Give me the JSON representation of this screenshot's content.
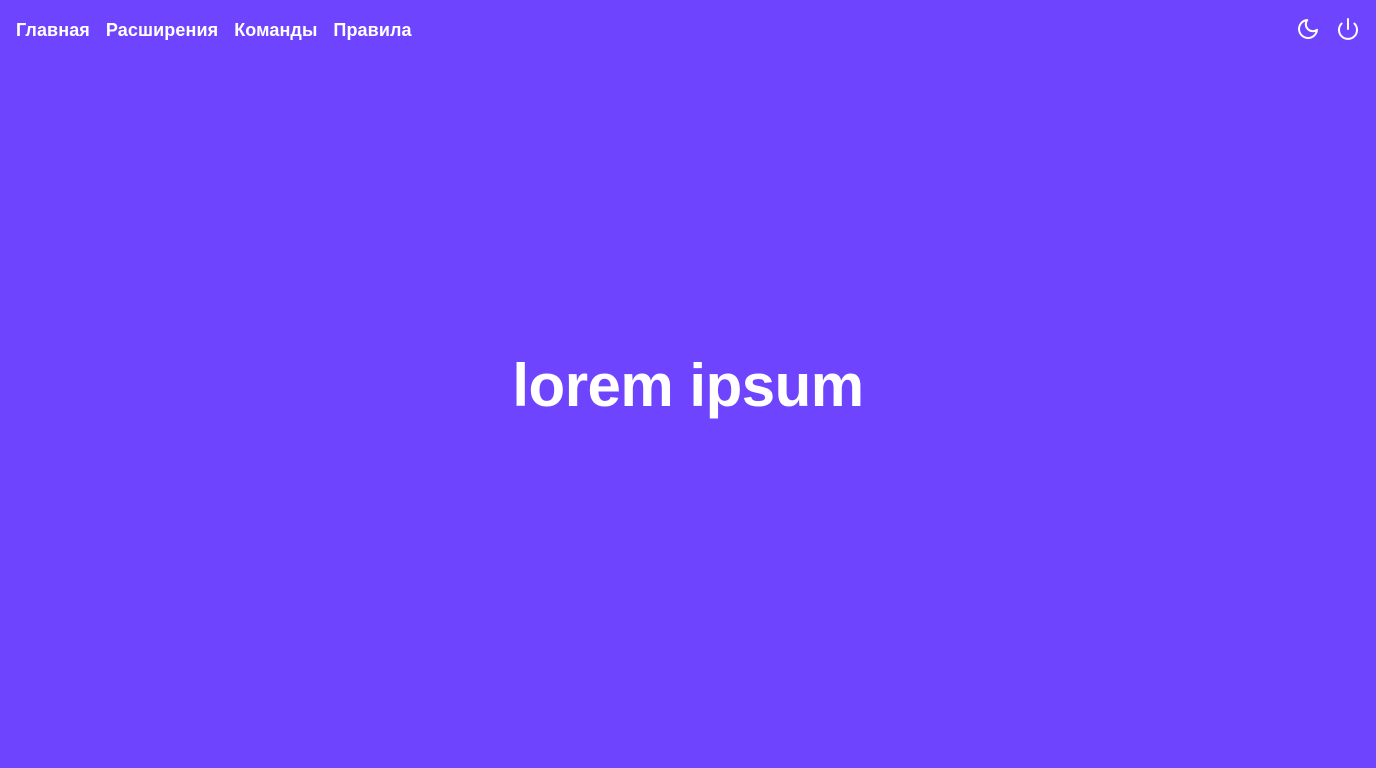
{
  "theme": {
    "background": "#6e44ff",
    "foreground": "#ffffff"
  },
  "nav": {
    "items": [
      {
        "label": "Главная"
      },
      {
        "label": "Расширения"
      },
      {
        "label": "Команды"
      },
      {
        "label": "Правила"
      }
    ]
  },
  "actions": {
    "theme_toggle_icon": "moon-icon",
    "power_icon": "power-icon"
  },
  "hero": {
    "title": "lorem ipsum"
  }
}
